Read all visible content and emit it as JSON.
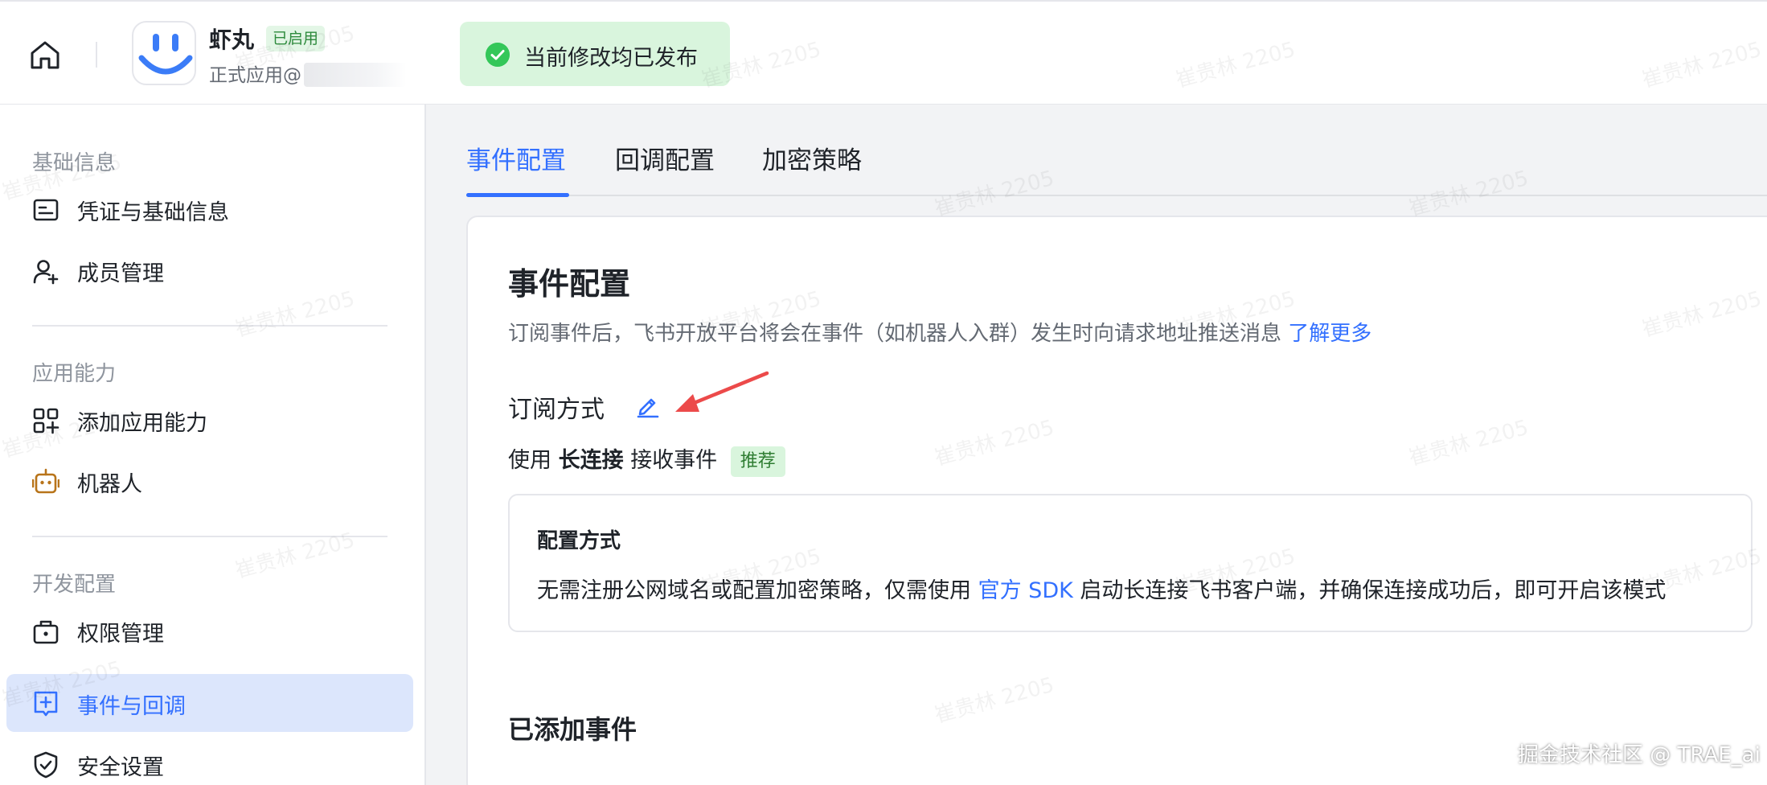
{
  "header": {
    "app_name": "虾丸",
    "status_badge": "已启用",
    "app_subtitle": "正式应用@",
    "toast_text": "当前修改均已发布"
  },
  "sidebar": {
    "groups": [
      {
        "label": "基础信息",
        "items": [
          {
            "label": "凭证与基础信息",
            "icon": "credential-icon"
          },
          {
            "label": "成员管理",
            "icon": "add-member-icon"
          }
        ]
      },
      {
        "label": "应用能力",
        "items": [
          {
            "label": "添加应用能力",
            "icon": "app-grid-icon"
          },
          {
            "label": "机器人",
            "icon": "robot-icon"
          }
        ]
      },
      {
        "label": "开发配置",
        "items": [
          {
            "label": "权限管理",
            "icon": "permission-icon"
          },
          {
            "label": "事件与回调",
            "icon": "event-icon"
          },
          {
            "label": "安全设置",
            "icon": "shield-icon"
          }
        ]
      }
    ],
    "active_item": "事件与回调"
  },
  "tabs": [
    {
      "label": "事件配置"
    },
    {
      "label": "回调配置"
    },
    {
      "label": "加密策略"
    }
  ],
  "content": {
    "title": "事件配置",
    "desc": "订阅事件后，飞书开放平台将会在事件（如机器人入群）发生时向请求地址推送消息",
    "desc_link": "了解更多",
    "subscribe_title": "订阅方式",
    "subscribe_prefix": "使用",
    "subscribe_method": "长连接",
    "subscribe_suffix": "接收事件",
    "recommend_tag": "推荐",
    "config_box_title": "配置方式",
    "config_text_before": "无需注册公网域名或配置加密策略，仅需使用",
    "config_link": "官方 SDK",
    "config_text_after": "启动长连接飞书客户端，并确保连接成功后，即可开启该模式",
    "added_events_title": "已添加事件"
  },
  "watermark": "崔贵林 2205",
  "corner_mark": "掘金技术社区 @ TRAE_ai",
  "colors": {
    "accent": "#3370ff",
    "success": "#34c759",
    "active_bg": "#dce6fc",
    "annotation_arrow": "#ec4a4a"
  }
}
